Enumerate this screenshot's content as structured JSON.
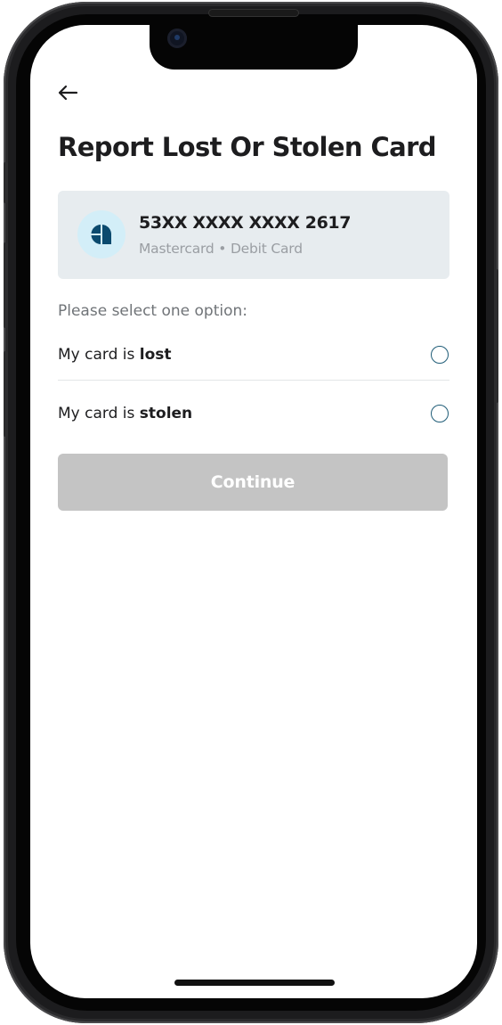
{
  "header": {
    "back_icon": "arrow-left-icon",
    "title": "Report Lost Or Stolen Card"
  },
  "card": {
    "logo_icon": "bank-logo-icon",
    "number": "53XX XXXX XXXX 2617",
    "meta": "Mastercard • Debit Card"
  },
  "options": {
    "prompt": "Please select one option:",
    "lost": {
      "prefix": "My card is ",
      "emphasis": "lost",
      "selected": false
    },
    "stolen": {
      "prefix": "My card is ",
      "emphasis": "stolen",
      "selected": false
    }
  },
  "actions": {
    "continue_label": "Continue",
    "continue_enabled": false
  },
  "colors": {
    "accent": "#1f5c77",
    "card_background": "#e7ecef",
    "disabled_button": "#c4c4c4",
    "logo_background": "#d3eef8",
    "logo_mark": "#0b4a6e"
  }
}
